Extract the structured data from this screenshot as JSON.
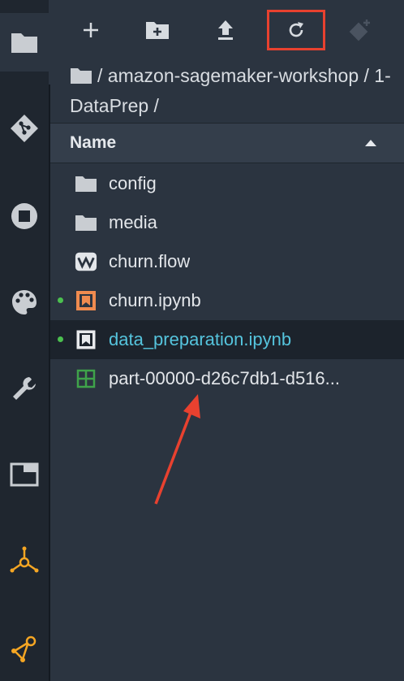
{
  "activity_bar": {
    "items": [
      {
        "name": "file-browser-icon",
        "active": true
      },
      {
        "name": "git-icon"
      },
      {
        "name": "running-sessions-icon"
      },
      {
        "name": "palette-icon"
      },
      {
        "name": "wrench-icon"
      },
      {
        "name": "window-icon"
      },
      {
        "name": "sagemaker-experiments-icon"
      },
      {
        "name": "sagemaker-resources-icon"
      }
    ]
  },
  "toolbar": {
    "buttons": [
      {
        "name": "new-launcher-button",
        "icon": "plus-icon"
      },
      {
        "name": "new-folder-button",
        "icon": "folder-plus-icon"
      },
      {
        "name": "upload-button",
        "icon": "upload-icon"
      },
      {
        "name": "refresh-button",
        "icon": "refresh-icon",
        "highlighted": true
      },
      {
        "name": "git-clone-button",
        "icon": "git-clone-icon",
        "disabled": true
      }
    ]
  },
  "breadcrumb": {
    "text": "/ amazon-sagemaker-workshop / 1-DataPrep /"
  },
  "list_header": {
    "name_label": "Name",
    "sort": "ascending"
  },
  "files": [
    {
      "name": "config",
      "type": "folder"
    },
    {
      "name": "media",
      "type": "folder"
    },
    {
      "name": "churn.flow",
      "type": "flow"
    },
    {
      "name": "churn.ipynb",
      "type": "notebook",
      "running": true
    },
    {
      "name": "data_preparation.ipynb",
      "type": "notebook",
      "running": true,
      "selected": true
    },
    {
      "name": "part-00000-d26c7db1-d516...",
      "type": "csv"
    }
  ],
  "colors": {
    "accent_selected_text": "#55c4dd",
    "highlight_box": "#e8412f",
    "running_dot": "#4bc04f",
    "notebook_orange": "#f08b4f",
    "csv_green": "#3fa34a",
    "sagemaker_orange": "#f5a623"
  }
}
